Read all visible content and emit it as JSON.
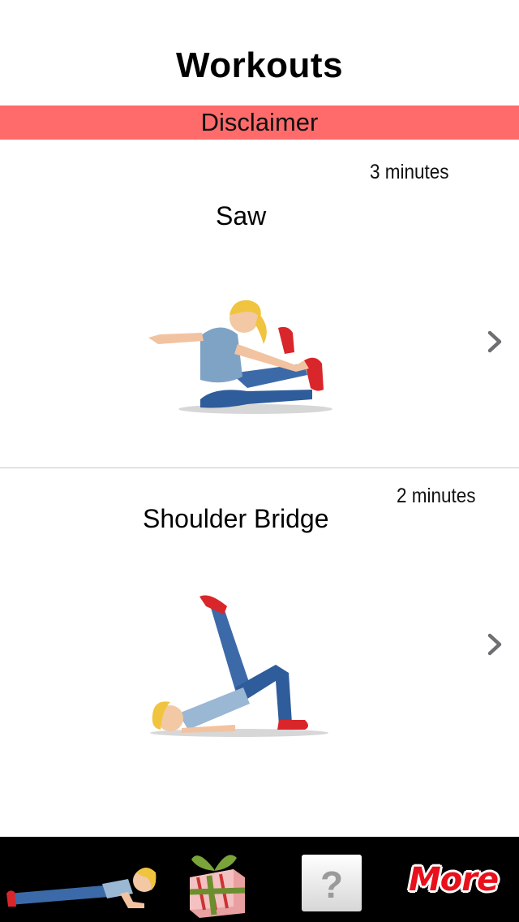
{
  "header": {
    "title": "Workouts"
  },
  "disclaimer": {
    "label": "Disclaimer"
  },
  "workouts": [
    {
      "name": "Saw",
      "duration": "3 minutes"
    },
    {
      "name": "Shoulder Bridge",
      "duration": "2 minutes"
    }
  ],
  "tabbar": {
    "tabs": [
      {
        "icon": "plank-figure-icon"
      },
      {
        "icon": "gift-icon"
      },
      {
        "icon": "help-icon",
        "glyph": "?"
      },
      {
        "label": "More"
      }
    ]
  },
  "colors": {
    "disclaimer_bg": "#ff6b6b",
    "tabbar_bg": "#000000",
    "more_text": "#e8101a"
  }
}
